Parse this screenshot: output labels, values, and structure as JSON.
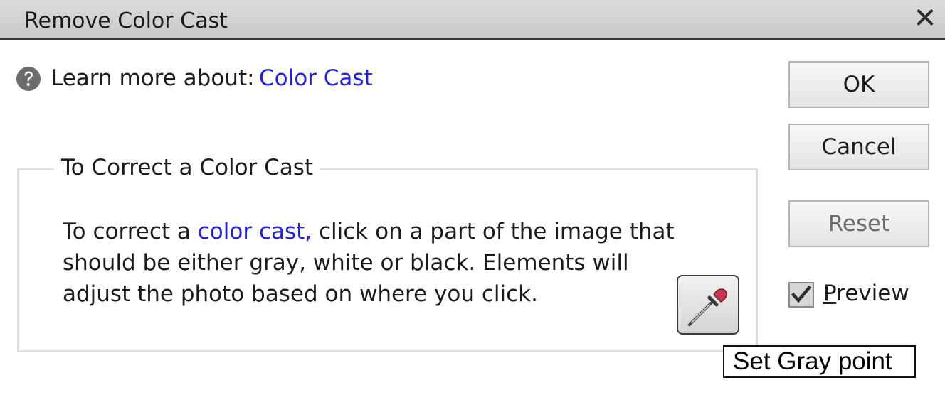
{
  "window": {
    "title": "Remove Color Cast",
    "close_icon": "close-icon"
  },
  "help": {
    "icon": "help-icon",
    "label": "Learn more about:",
    "link": "Color Cast"
  },
  "group": {
    "legend": "To Correct a Color Cast",
    "text_before_link": "To correct a ",
    "link": "color cast,",
    "text_after_link": "  click on a part of the image that should be either gray, white or black. Elements will adjust the photo based on where you click.",
    "eyedropper_icon": "eyedropper-icon"
  },
  "buttons": {
    "ok": "OK",
    "cancel": "Cancel",
    "reset": "Reset"
  },
  "preview": {
    "mnemonic": "P",
    "rest": "review",
    "checked": true
  },
  "tooltip": {
    "text": "Set Gray point"
  },
  "colors": {
    "link": "#2020e8",
    "titlebar": "#d2d2d2",
    "eyedropper_tip": "#c8374f"
  }
}
